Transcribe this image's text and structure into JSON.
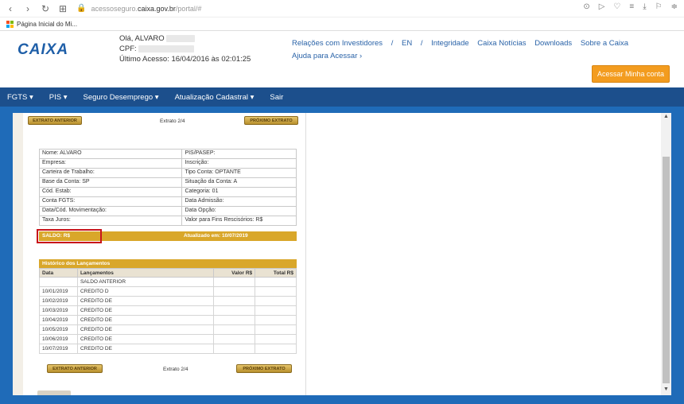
{
  "browser": {
    "url_prefix": "acessoseguro.",
    "url_host": "caixa.gov.br",
    "url_path": "/portal/#",
    "bookmark": "Página Inicial do Mi..."
  },
  "header": {
    "logo": "CAIXA",
    "greeting": "Olá, ALVARO",
    "cpf_label": "CPF:",
    "last_access": "Último Acesso: 16/04/2016 às 02:01:25",
    "links": [
      "Relações com Investidores",
      "/",
      "EN",
      "/",
      "Integridade",
      "Caixa Notícias",
      "Downloads",
      "Sobre a Caixa"
    ],
    "help": "Ajuda para Acessar ›",
    "access_button": "Acessar Minha conta"
  },
  "nav": [
    "FGTS ▾",
    "PIS ▾",
    "Seguro Desemprego ▾",
    "Atualização Cadastral ▾",
    "Sair"
  ],
  "extract": {
    "prev_button": "EXTRATO ANTERIOR",
    "next_button": "PRÓXIMO EXTRATO",
    "page_label": "Extrato 2/4",
    "info_rows": [
      [
        "Nome: ALVARO",
        "PIS/PASEP:"
      ],
      [
        "Empresa:",
        "Inscrição:"
      ],
      [
        "Carteira de Trabalho:",
        "Tipo Conta: OPTANTE"
      ],
      [
        "Base da Conta: SP",
        "Situação da Conta: A"
      ],
      [
        "Cód. Estab:",
        "Categoria: 01"
      ],
      [
        "Conta FGTS:",
        "Data Admissão:"
      ],
      [
        "Data/Cód. Movimentação:",
        "Data Opção:"
      ],
      [
        "Taxa Juros:",
        "Valor para Fins Rescisórios: R$"
      ]
    ],
    "saldo_label": "SALDO: R$",
    "updated": "Atualizado em: 10/07/2019",
    "history_title": "Histórico dos Lançamentos",
    "history_headers": [
      "Data",
      "Lançamentos",
      "Valor R$",
      "Total R$"
    ],
    "history_rows": [
      [
        "",
        "SALDO ANTERIOR",
        "",
        ""
      ],
      [
        "10/01/2019",
        "CREDITO D",
        "",
        ""
      ],
      [
        "10/02/2019",
        "CREDITO DE",
        "",
        ""
      ],
      [
        "10/03/2019",
        "CREDITO DE",
        "",
        ""
      ],
      [
        "10/04/2019",
        "CREDITO DE",
        "",
        ""
      ],
      [
        "10/05/2019",
        "CREDITO DE",
        "",
        ""
      ],
      [
        "10/06/2019",
        "CREDITO DE",
        "",
        ""
      ],
      [
        "10/07/2019",
        "CREDITO DE",
        "",
        ""
      ]
    ]
  }
}
